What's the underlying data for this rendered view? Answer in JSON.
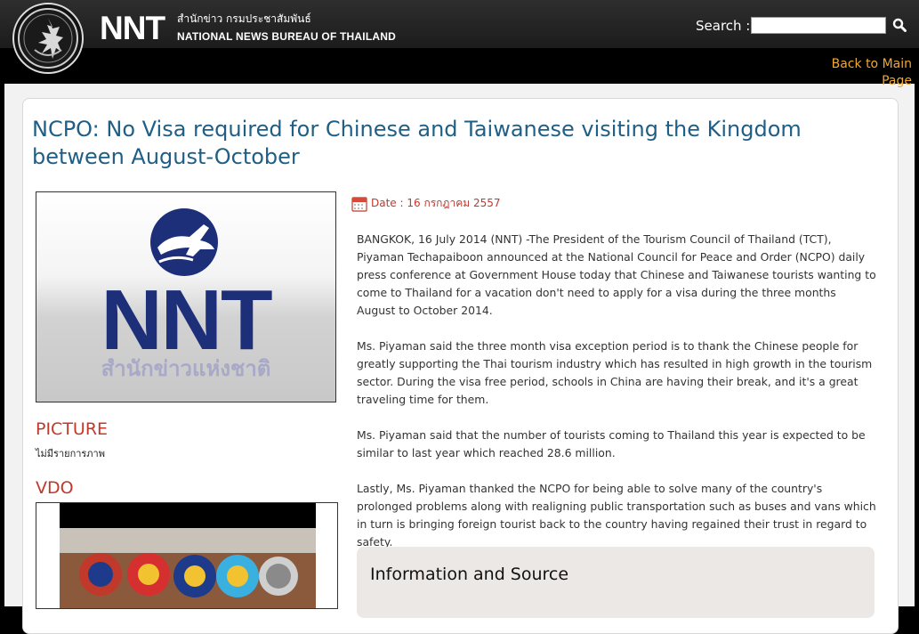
{
  "header": {
    "logo_mark": "NNT",
    "logo_thai": "สำนักข่าว กรมประชาสัมพันธ์",
    "logo_english": "NATIONAL NEWS BUREAU OF THAILAND",
    "search_label": "Search :",
    "search_value": "",
    "search_icon": "magnifier-icon"
  },
  "nav": {
    "back_link": "Back to Main Page"
  },
  "article": {
    "title": "NCPO: No Visa required for Chinese and Taiwanese visiting the Kingdom between August-October",
    "date_icon": "calendar-icon",
    "date": "Date : 16 กรกฎาคม 2557",
    "paragraphs": [
      "BANGKOK, 16 July 2014 (NNT) -The President of the Tourism Council of Thailand (TCT), Piyaman Techapaiboon announced at the National Council for Peace and Order (NCPO) daily press conference at Government House today that Chinese and Taiwanese tourists wanting to come to Thailand for a vacation don't need to apply for a visa during the three months August to October 2014.",
      "Ms. Piyaman said the three month visa exception period is to thank the Chinese people for greatly supporting the Thai tourism industry which has resulted in high growth in the tourism sector. During the visa free period, schools in China are having their break, and it's a great traveling time for them.",
      "Ms. Piyaman said that the number of tourists coming to Thailand this year is expected to be similar to last year which reached 28.6 million.",
      "Lastly, Ms. Piyaman thanked the NCPO for being able to solve many of the country's prolonged problems along with realigning public transportation such as buses and vans which in turn is bringing foreign tourist back to the country having regained their trust in regard to safety."
    ]
  },
  "photo": {
    "logo_text": "NNT",
    "thai_caption": "สำนักข่าวแห่งชาติ"
  },
  "sidebar": {
    "picture_heading": "PICTURE",
    "picture_note": "ไม่มีรายการภาพ",
    "vdo_heading": "VDO"
  },
  "info": {
    "title": "Information and Source"
  },
  "colors": {
    "title_blue": "#1f5f86",
    "accent_red": "#c0392b",
    "link_orange": "#f0a830",
    "logo_navy": "#1e2f7a"
  }
}
